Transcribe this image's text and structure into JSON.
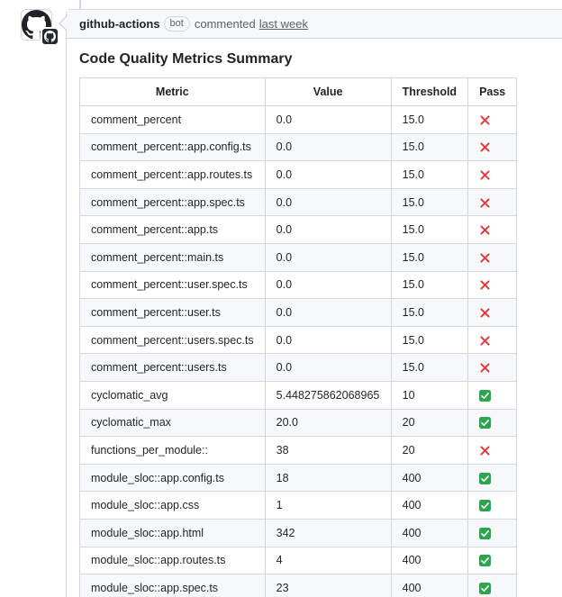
{
  "comment": {
    "author": "github-actions",
    "bot_label": "bot",
    "verb": "commented",
    "timestamp": "last week",
    "heading": "Code Quality Metrics Summary"
  },
  "table": {
    "headers": [
      "Metric",
      "Value",
      "Threshold",
      "Pass"
    ],
    "rows": [
      {
        "metric": "comment_percent",
        "value": "0.0",
        "threshold": "15.0",
        "pass": false
      },
      {
        "metric": "comment_percent::app.config.ts",
        "value": "0.0",
        "threshold": "15.0",
        "pass": false
      },
      {
        "metric": "comment_percent::app.routes.ts",
        "value": "0.0",
        "threshold": "15.0",
        "pass": false
      },
      {
        "metric": "comment_percent::app.spec.ts",
        "value": "0.0",
        "threshold": "15.0",
        "pass": false
      },
      {
        "metric": "comment_percent::app.ts",
        "value": "0.0",
        "threshold": "15.0",
        "pass": false
      },
      {
        "metric": "comment_percent::main.ts",
        "value": "0.0",
        "threshold": "15.0",
        "pass": false
      },
      {
        "metric": "comment_percent::user.spec.ts",
        "value": "0.0",
        "threshold": "15.0",
        "pass": false
      },
      {
        "metric": "comment_percent::user.ts",
        "value": "0.0",
        "threshold": "15.0",
        "pass": false
      },
      {
        "metric": "comment_percent::users.spec.ts",
        "value": "0.0",
        "threshold": "15.0",
        "pass": false
      },
      {
        "metric": "comment_percent::users.ts",
        "value": "0.0",
        "threshold": "15.0",
        "pass": false
      },
      {
        "metric": "cyclomatic_avg",
        "value": "5.448275862068965",
        "threshold": "10",
        "pass": true
      },
      {
        "metric": "cyclomatic_max",
        "value": "20.0",
        "threshold": "20",
        "pass": true
      },
      {
        "metric": "functions_per_module::",
        "value": "38",
        "threshold": "20",
        "pass": false
      },
      {
        "metric": "module_sloc::app.config.ts",
        "value": "18",
        "threshold": "400",
        "pass": true
      },
      {
        "metric": "module_sloc::app.css",
        "value": "1",
        "threshold": "400",
        "pass": true
      },
      {
        "metric": "module_sloc::app.html",
        "value": "342",
        "threshold": "400",
        "pass": true
      },
      {
        "metric": "module_sloc::app.routes.ts",
        "value": "4",
        "threshold": "400",
        "pass": true
      },
      {
        "metric": "module_sloc::app.spec.ts",
        "value": "23",
        "threshold": "400",
        "pass": true
      }
    ]
  },
  "icons": {
    "avatar": "github-mark-icon",
    "badge": "github-app-badge-icon",
    "pass_true": "green-check-icon",
    "pass_false": "red-x-icon"
  },
  "colors": {
    "fail": "#e5383b",
    "pass": "#2da44e"
  }
}
